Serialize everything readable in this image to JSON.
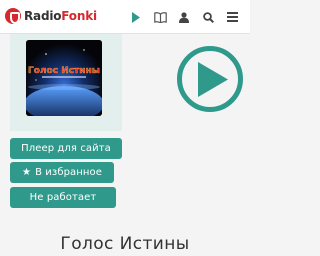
{
  "header": {
    "logo_prefix": "Radio",
    "logo_suffix": "Fonki",
    "nav_icons": [
      "play-icon",
      "book-icon",
      "user-icon",
      "search-icon",
      "menu-icon"
    ]
  },
  "station": {
    "cover_text": "Голос Истины",
    "title": "Голос Истины"
  },
  "actions": {
    "player_label": "Плеер для сайта",
    "favorite_label": "В избранное",
    "broken_label": "Не работает"
  },
  "colors": {
    "accent": "#2f9a8c",
    "brand_red": "#d6292e"
  }
}
